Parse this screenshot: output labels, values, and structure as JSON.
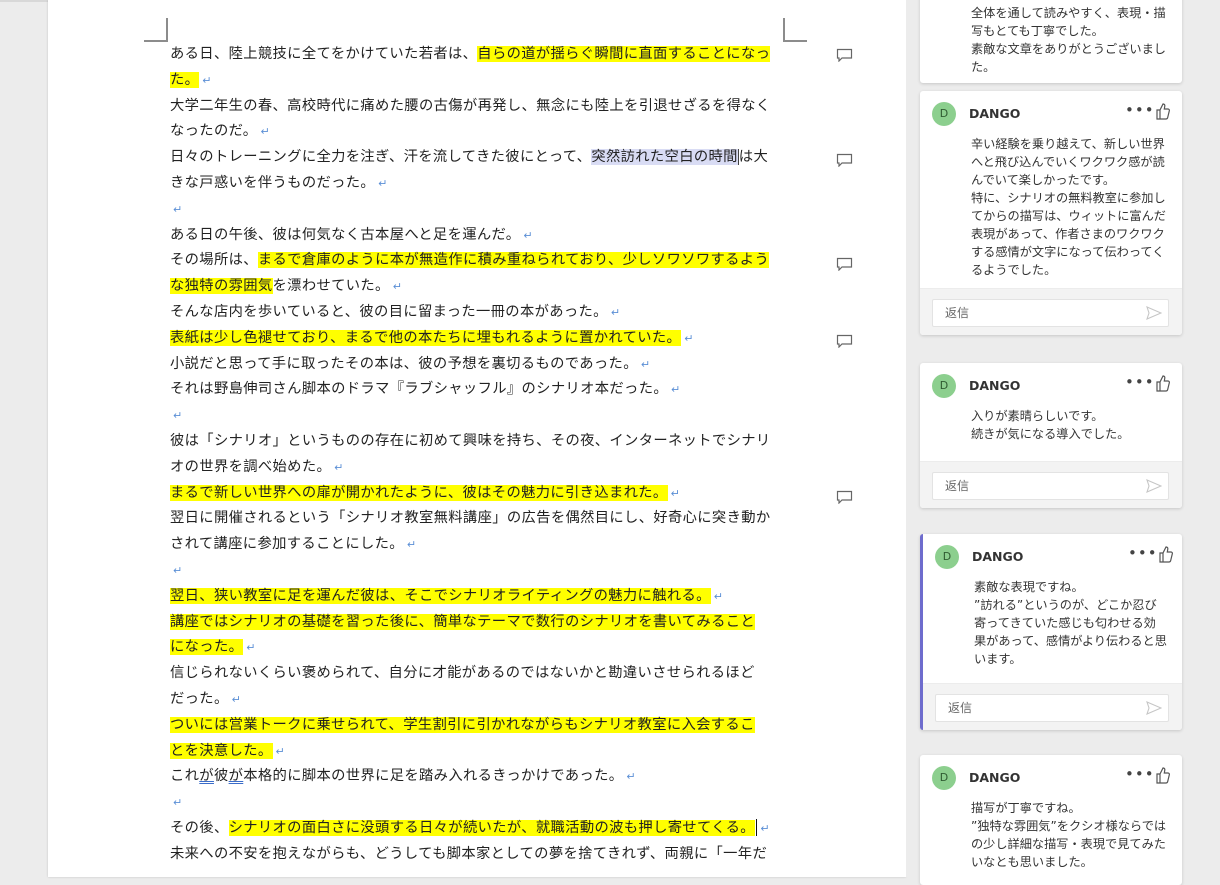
{
  "document": {
    "lines": [
      [
        {
          "t": "ある日、陸上競技に全てをかけていた若者は、"
        },
        {
          "t": "自らの道が揺らぐ瞬間に直面することになっ",
          "hl": true
        }
      ],
      [
        {
          "t": "た。",
          "hl": true
        },
        {
          "pm": true
        }
      ],
      [
        {
          "t": "大学二年生の春、高校時代に痛めた腰の古傷が再発し、無念にも陸上を引退せざるを得なく"
        }
      ],
      [
        {
          "t": "なったのだ。"
        },
        {
          "pm": true
        }
      ],
      [
        {
          "t": "日々のトレーニングに全力を注ぎ、汗を流してきた彼にとって、"
        },
        {
          "t": "突然訪れた空白の時間",
          "sel": true
        },
        {
          "t": "は大"
        }
      ],
      [
        {
          "t": "きな戸惑いを伴うものだった。"
        },
        {
          "pm": true
        }
      ],
      [
        {
          "pm": true
        }
      ],
      [
        {
          "t": "ある日の午後、彼は何気なく古本屋へと足を運んだ。"
        },
        {
          "pm": true
        }
      ],
      [
        {
          "t": "その場所は、"
        },
        {
          "t": "まるで倉庫のように本が無造作に積み重ねられており、少しソワソワするよう",
          "hl": true
        }
      ],
      [
        {
          "t": "な独特の雰囲気",
          "hl": true
        },
        {
          "t": "を漂わせていた。"
        },
        {
          "pm": true
        }
      ],
      [
        {
          "t": "そんな店内を歩いていると、彼の目に留まった一冊の本があった。"
        },
        {
          "pm": true
        }
      ],
      [
        {
          "t": "表紙は少し色褪せており、まるで他の本たちに埋もれるように置かれていた。",
          "hl": true
        },
        {
          "pm": true
        }
      ],
      [
        {
          "t": "小説だと思って手に取ったその本は、彼の予想を裏切るものであった。"
        },
        {
          "pm": true
        }
      ],
      [
        {
          "t": "それは野島伸司さん脚本のドラマ『ラブシャッフル』のシナリオ本だった。"
        },
        {
          "pm": true
        }
      ],
      [
        {
          "pm": true
        }
      ],
      [
        {
          "t": "彼は「シナリオ」というものの存在に初めて興味を持ち、その夜、インターネットでシナリ"
        }
      ],
      [
        {
          "t": "オの世界を調べ始めた。"
        },
        {
          "pm": true
        }
      ],
      [
        {
          "t": "まるで新しい世界への扉が開かれたように、彼はその魅力に引き込まれた。",
          "hl": true
        },
        {
          "pm": true
        }
      ],
      [
        {
          "t": "翌日に開催されるという「シナリオ教室無料講座」の広告を偶然目にし、好奇心に突き動か"
        }
      ],
      [
        {
          "t": "されて講座に参加することにした。"
        },
        {
          "pm": true
        }
      ],
      [
        {
          "pm": true
        }
      ],
      [
        {
          "t": "翌日、狭い教室に足を運んだ彼は、そこでシナリオライティングの魅力に触れる。",
          "hl": true
        },
        {
          "pm": true
        }
      ],
      [
        {
          "t": "講座ではシナリオの基礎を習った後に、簡単なテーマで数行のシナリオを書いてみること",
          "hl": true
        }
      ],
      [
        {
          "t": "になった。",
          "hl": true
        },
        {
          "pm": true
        }
      ],
      [
        {
          "t": "信じられないくらい褒められて、自分に才能があるのではないかと勘違いさせられるほど"
        }
      ],
      [
        {
          "t": "だった。"
        },
        {
          "pm": true
        }
      ],
      [
        {
          "t": "ついには営業トークに乗せられて、学生割引に引かれながらもシナリオ教室に入会するこ",
          "hl": true
        }
      ],
      [
        {
          "t": "とを決意した。",
          "hl": true
        },
        {
          "pm": true
        }
      ],
      [
        {
          "t": "これ"
        },
        {
          "t": "が",
          "ul": true
        },
        {
          "t": "彼"
        },
        {
          "t": "が",
          "ul": true
        },
        {
          "t": "本格的に脚本の世界に足を踏み入れるきっかけであった。"
        },
        {
          "pm": true
        }
      ],
      [
        {
          "pm": true
        }
      ],
      [
        {
          "t": "その後、"
        },
        {
          "t": "シナリオの面白さに没頭する日々が続いたが、就職活動の波も押し寄せてくる。",
          "hl": true
        },
        {
          "cursor": true
        },
        {
          "pm": true
        }
      ],
      [
        {
          "t": "未来への不安を抱えながらも、どうしても脚本家としての夢を捨てきれず、両親に「一年だ"
        }
      ]
    ],
    "paragraph_mark": "↵"
  },
  "comments": {
    "partial": {
      "text": "全体を通して読みやすく、表現・描写もとても丁寧でした。\n素敵な文章をありがとうございました。"
    },
    "cards": [
      {
        "initial": "D",
        "author": "DANGO",
        "more": "•••",
        "text": "辛い経験を乗り越えて、新しい世界へと飛び込んでいくワクワク感が読んでいて楽しかったです。\n特に、シナリオの無料教室に参加してからの描写は、ウィットに富んだ表現があって、作者さまのワクワクする感情が文字になって伝わってくるようでした。",
        "reply_placeholder": "返信"
      },
      {
        "initial": "D",
        "author": "DANGO",
        "more": "•••",
        "text": "入りが素晴らしいです。\n続きが気になる導入でした。",
        "reply_placeholder": "返信"
      },
      {
        "initial": "D",
        "author": "DANGO",
        "more": "•••",
        "text": "素敵な表現ですね。\n”訪れる”というのが、どこか忍び寄ってきていた感じも匂わせる効果があって、感情がより伝わると思います。",
        "reply_placeholder": "返信"
      },
      {
        "initial": "D",
        "author": "DANGO",
        "more": "•••",
        "text": "描写が丁寧ですね。\n”独特な雰囲気”をクシオ様ならではの少し詳細な描写・表現で見てみたいなとも思いました。"
      }
    ]
  },
  "colors": {
    "highlight": "#ffff00",
    "selection": "#d9dcf4",
    "active_comment_border": "#6e6ccd",
    "avatar": "#8ccf8e"
  },
  "icons": {
    "comment_marker": "speech-bubble-icon",
    "like": "thumbs-up-icon",
    "send": "send-arrow-icon"
  }
}
